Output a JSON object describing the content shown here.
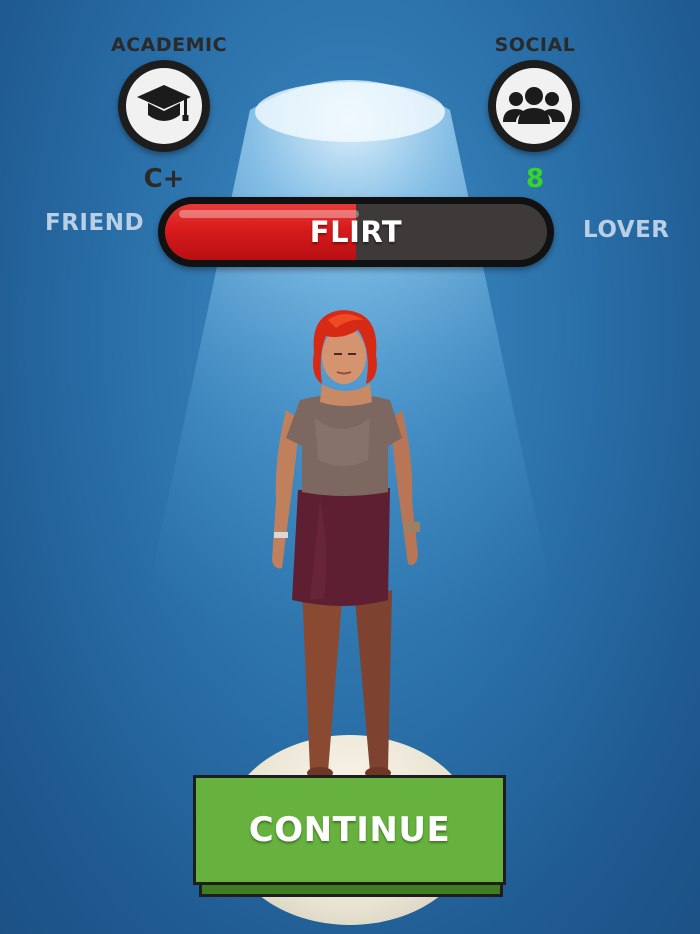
{
  "stats": {
    "academic": {
      "label": "ACADEMIC",
      "grade": "C+",
      "icon": "graduation-cap-icon",
      "grade_color": "#2a2a2a"
    },
    "social": {
      "label": "SOCIAL",
      "grade": "8",
      "icon": "group-icon",
      "grade_color": "#36d52a"
    }
  },
  "relationship": {
    "left_label": "FRIEND",
    "right_label": "LOVER",
    "status": "FLIRT",
    "level": 0.5,
    "fill_color": "#d81b1b"
  },
  "continue_button": {
    "label": "CONTINUE",
    "color": "#67b23e"
  }
}
